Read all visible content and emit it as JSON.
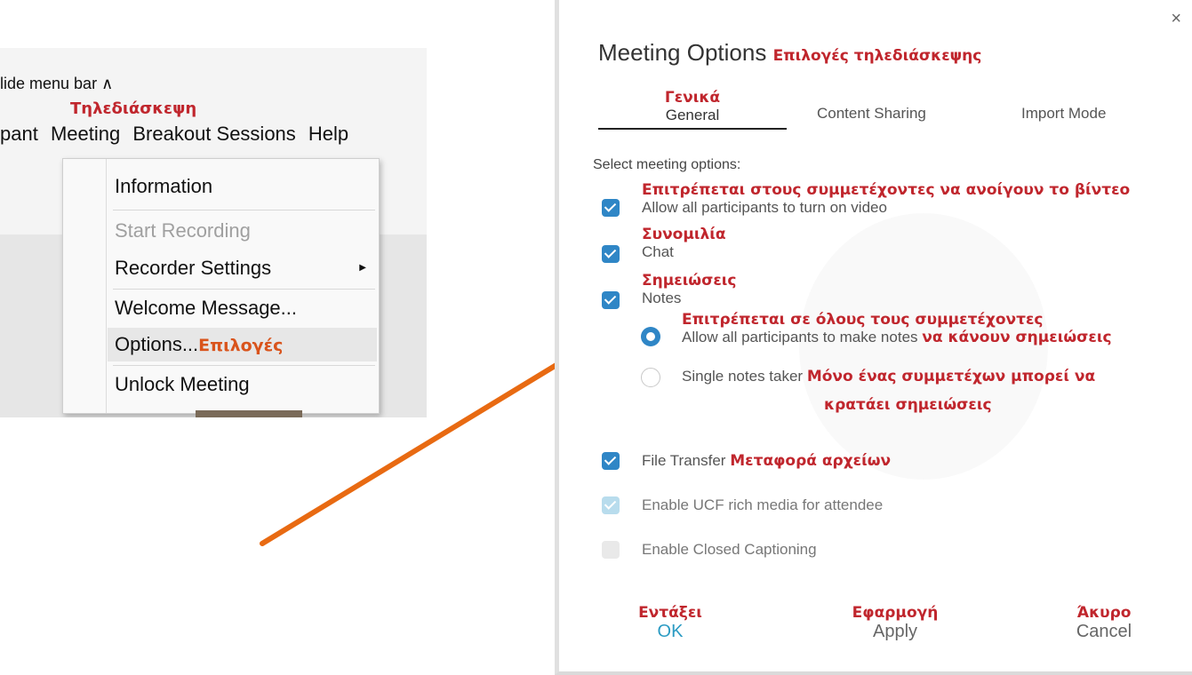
{
  "menu": {
    "hide_menu_bar": "lide menu bar ∧",
    "meeting_red": "Τηλεδιάσκεψη",
    "bar": {
      "participant": "pant",
      "meeting": "Meeting",
      "breakout": "Breakout Sessions",
      "help": "Help"
    },
    "items": {
      "information": "Information",
      "start_recording": "Start Recording",
      "recorder_settings": "Recorder Settings",
      "welcome": "Welcome Message...",
      "options": "Options...",
      "options_red": "Επιλογές",
      "unlock": "Unlock Meeting"
    }
  },
  "dialog": {
    "close": "×",
    "title": "Meeting Options",
    "title_red": "Επιλογές τηλεδιάσκεψης",
    "tabs": {
      "general_red": "Γενικά",
      "general": "General",
      "content_sharing": "Content Sharing",
      "import_mode": "Import Mode"
    },
    "select_label": "Select meeting options:",
    "options": {
      "video_red": "Επιτρέπεται στους συμμετέχοντες να ανοίγουν το βίντεο",
      "video": "Allow all participants to turn on video",
      "chat_red": "Συνομιλία",
      "chat": "Chat",
      "notes_red": "Σημειώσεις",
      "notes": "Notes",
      "all_notes_red_1": "Επιτρέπεται σε όλους τους συμμετέχοντες",
      "all_notes": "Allow all participants to make notes",
      "all_notes_red_2": "να κάνουν σημειώσεις",
      "single_notes": "Single notes taker",
      "single_notes_red_1": "Μόνο ένας συμμετέχων μπορεί να",
      "single_notes_red_2": "κρατάει σημειώσεις",
      "file_transfer": "File Transfer",
      "file_transfer_red": "Μεταφορά αρχείων",
      "ucf": "Enable UCF rich media for attendee",
      "captioning": "Enable Closed Captioning"
    },
    "buttons": {
      "ok_red": "Εντάξει",
      "ok": "OK",
      "apply_red": "Εφαρμογή",
      "apply": "Apply",
      "cancel_red": "Άκυρο",
      "cancel": "Cancel"
    }
  },
  "colors": {
    "annotation_red": "#c0262d",
    "checkbox_blue": "#2f86c6",
    "arrow_orange": "#e86a12",
    "ok_teal": "#2b9bc3"
  }
}
